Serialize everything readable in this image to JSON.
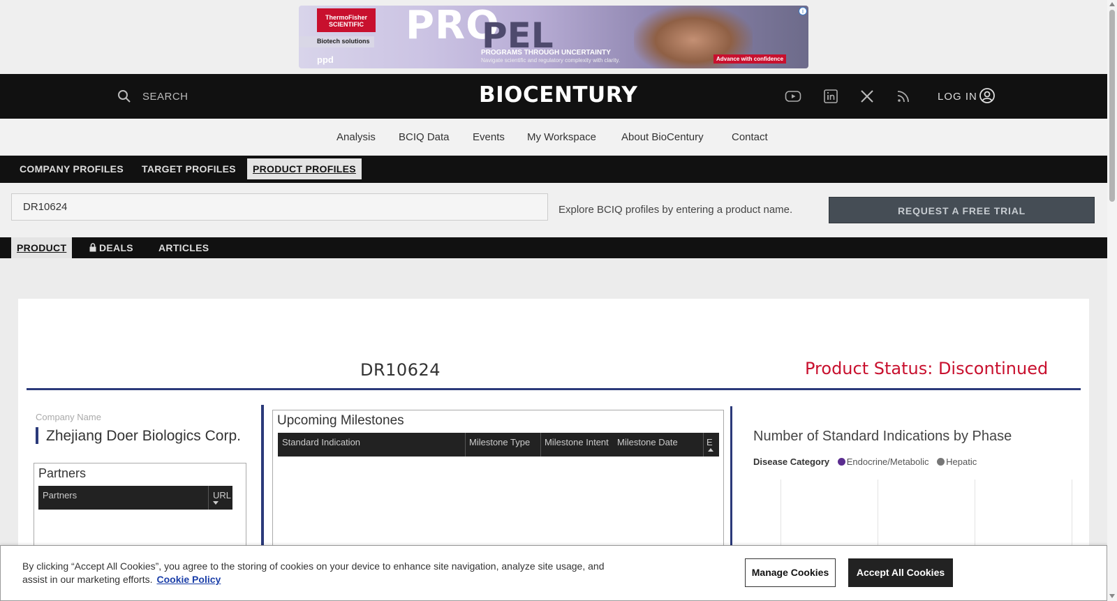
{
  "ad": {
    "brand": "ThermoFisher SCIENTIFIC",
    "tag": "Biotech solutions",
    "sub_brand": "ppd",
    "headline_a": "PRO",
    "headline_b": "PEL",
    "line1": "PROGRAMS THROUGH UNCERTAINTY",
    "line2": "Navigate scientific and regulatory complexity with clarity.",
    "cta": "Advance with confidence",
    "info_icon": "info-icon"
  },
  "header": {
    "search_label": "SEARCH",
    "logo": "BIOCENTURY",
    "social": [
      "youtube-icon",
      "linkedin-icon",
      "x-icon",
      "rss-icon"
    ],
    "login_label": "LOG IN",
    "accent": "#c8102e"
  },
  "main_nav": [
    "Analysis",
    "BCIQ Data",
    "Events",
    "My Workspace",
    "About BioCentury",
    "Contact"
  ],
  "profile_tabs": [
    "COMPANY PROFILES",
    "TARGET PROFILES",
    "PRODUCT PROFILES"
  ],
  "search": {
    "value": "DR10624",
    "hint": "Explore BCIQ profiles by entering a product name.",
    "trial_button": "REQUEST A FREE TRIAL"
  },
  "product_tabs": [
    "PRODUCT",
    "DEALS",
    "ARTICLES"
  ],
  "product": {
    "name": "DR10624",
    "status": "Product Status: Discontinued",
    "status_color": "#c8102e",
    "company_label": "Company Name",
    "company_name": "Zhejiang Doer Biologics Corp."
  },
  "partners": {
    "title": "Partners",
    "columns": [
      "Partners",
      "URL"
    ]
  },
  "milestones": {
    "title": "Upcoming Milestones",
    "columns": [
      "Standard Indication",
      "Milestone Type",
      "Milestone Intent",
      "Milestone Date",
      "E"
    ]
  },
  "indications_chart": {
    "title": "Number of Standard Indications by Phase",
    "legend_label": "Disease Category",
    "categories": [
      {
        "name": "Endocrine/Metabolic",
        "color": "#5b2d90"
      },
      {
        "name": "Hepatic",
        "color": "#777777"
      }
    ]
  },
  "cookie": {
    "text": "By clicking “Accept All Cookies”, you agree to the storing of cookies on your device to enhance site navigation, analyze site usage, and assist in our marketing efforts.",
    "policy_link": "Cookie Policy",
    "manage_button": "Manage Cookies",
    "accept_button": "Accept All Cookies"
  }
}
